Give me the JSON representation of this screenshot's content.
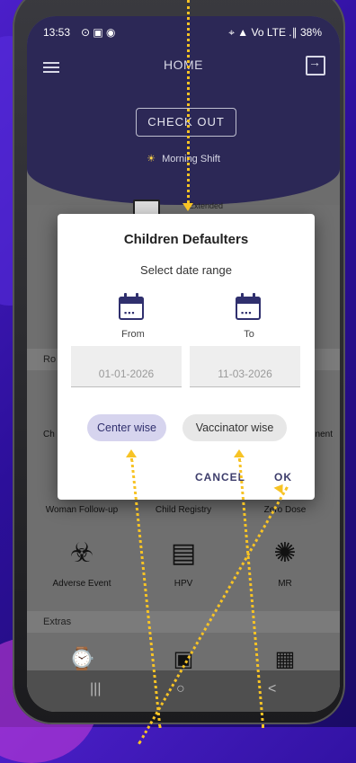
{
  "status_bar": {
    "time": "13:53",
    "indicators": "⊙ ▣ ◉",
    "right": "⌖ ▲ Vo LTE .∥ 38%"
  },
  "app_bar": {
    "title": "HOME",
    "checkout_label": "CHECK OUT",
    "shift_label": "Morning Shift"
  },
  "extended": {
    "label": "Extended"
  },
  "sections": {
    "routine_label": "Ro",
    "extras_label": "Extras"
  },
  "grid": {
    "side_left_label": "Ch",
    "side_right_label": "nent",
    "row2": [
      "Woman Follow-up",
      "Child Registry",
      "Zero Dose"
    ],
    "row3": [
      "Adverse Event",
      "HPV",
      "MR"
    ]
  },
  "dialog": {
    "title": "Children Defaulters",
    "subtitle": "Select date range",
    "from_label": "From",
    "to_label": "To",
    "from_date": "01-01-2026",
    "to_date": "11-03-2026",
    "chip_center": "Center wise",
    "chip_vaccinator": "Vaccinator wise",
    "cancel_label": "CANCEL",
    "ok_label": "OK"
  },
  "nav": {
    "recent": "|||",
    "home": "○",
    "back": "<"
  },
  "colors": {
    "primary": "#2c2856",
    "accent_dots": "#f7c325",
    "chip_selected": "#d6d4ee"
  }
}
